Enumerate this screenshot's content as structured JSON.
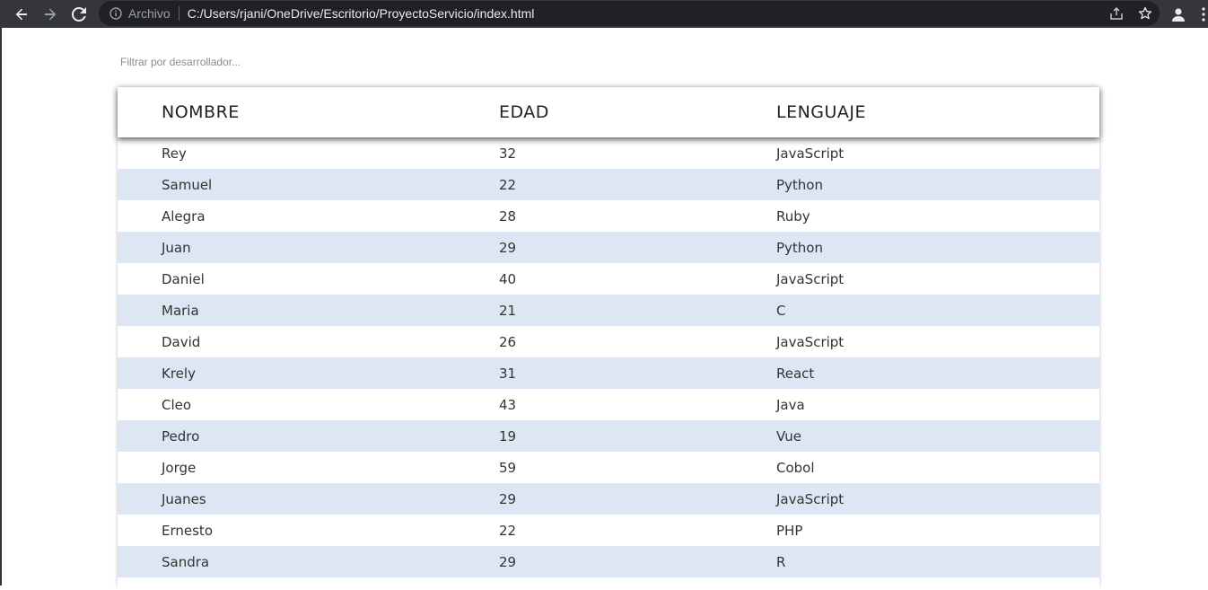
{
  "browser": {
    "scheme_label": "Archivo",
    "url": "C:/Users/rjani/OneDrive/Escritorio/ProyectoServicio/index.html"
  },
  "filter": {
    "placeholder": "Filtrar por desarrollador..."
  },
  "table": {
    "headers": [
      "NOMBRE",
      "EDAD",
      "LENGUAJE"
    ],
    "rows": [
      [
        "Rey",
        "32",
        "JavaScript"
      ],
      [
        "Samuel",
        "22",
        "Python"
      ],
      [
        "Alegra",
        "28",
        "Ruby"
      ],
      [
        "Juan",
        "29",
        "Python"
      ],
      [
        "Daniel",
        "40",
        "JavaScript"
      ],
      [
        "Maria",
        "21",
        "C"
      ],
      [
        "David",
        "26",
        "JavaScript"
      ],
      [
        "Krely",
        "31",
        "React"
      ],
      [
        "Cleo",
        "43",
        "Java"
      ],
      [
        "Pedro",
        "19",
        "Vue"
      ],
      [
        "Jorge",
        "59",
        "Cobol"
      ],
      [
        "Juanes",
        "29",
        "JavaScript"
      ],
      [
        "Ernesto",
        "22",
        "PHP"
      ],
      [
        "Sandra",
        "29",
        "R"
      ]
    ]
  },
  "colors": {
    "toolbar": "#35363a",
    "omnibox": "#202124",
    "row_stripe": "#dde6f2"
  }
}
